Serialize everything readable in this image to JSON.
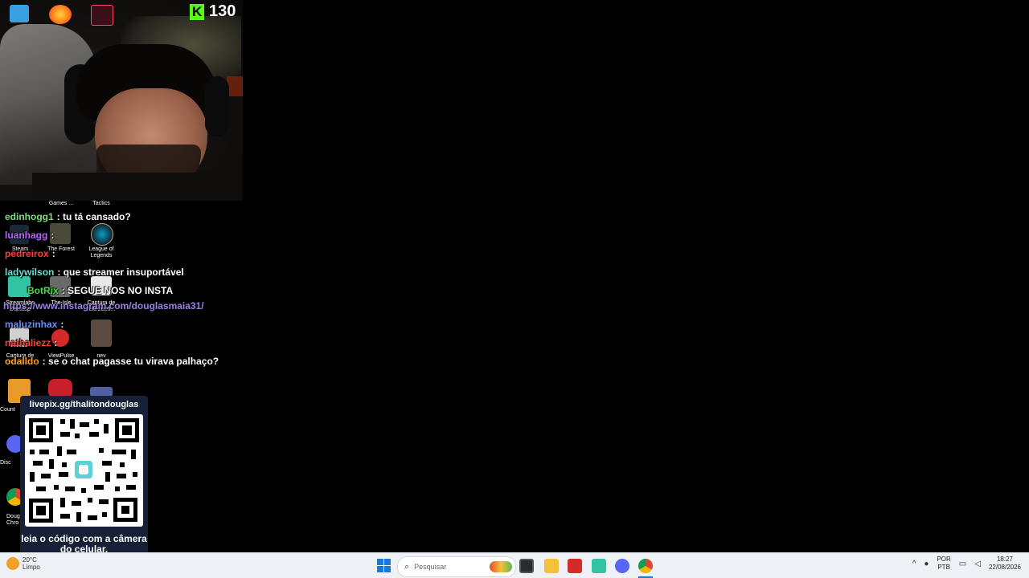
{
  "counter": {
    "value": "130"
  },
  "desktop_labels": {
    "games": "Games ...",
    "tactics": "Tactics",
    "steam": "Steam",
    "the_forest": "The Forest",
    "league": "League of Legends",
    "streamlabs": "Streamlabs Desktop",
    "the_isle": "The Isle",
    "captura1": "Captura de tela 2026...",
    "captura2": "Captura de tela 2026...",
    "viewpulse": "ViewPulse",
    "nev": "nev",
    "counter_strike": "Count",
    "discord": "Disc",
    "chrome": "Doug Chro"
  },
  "chat": {
    "m1": {
      "user": "edinhogg1",
      "sep": ":",
      "text": "tu tá cansado?"
    },
    "m2": {
      "user": "luanhagg",
      "sep": ":",
      "text": ""
    },
    "m3": {
      "user": "pedreirox",
      "sep": ":",
      "text": ""
    },
    "m4": {
      "user": "ladywilson",
      "sep": ":",
      "text": "que streamer insuportável"
    },
    "m5": {
      "user": "BotRix",
      "sep": ":",
      "text": "SEGUE NOS NO INSTA"
    },
    "link": "https://www.instagram.com/douglasmaia31/",
    "m6": {
      "user": "maluzinhax",
      "sep": ":",
      "text": ""
    },
    "m7": {
      "user": "nathaliezz",
      "sep": ":",
      "text": ""
    },
    "m8": {
      "user": "odalldo",
      "sep": ":",
      "text": "se o chat pagasse tu virava palhaço?"
    }
  },
  "colors": {
    "edinhogg1": "#7be07b",
    "luanhagg": "#b266ff",
    "pedreirox": "#ff3b3b",
    "ladywilson": "#5fe0d0",
    "BotRix": "#49d84b",
    "maluzinhax": "#6b8cff",
    "nathaliezz": "#ff3b3b",
    "odalldo": "#ff9f1a"
  },
  "qr": {
    "url": "livepix.gg/thalitondouglas",
    "caption": "leia o código com a câmera do celular."
  },
  "taskbar": {
    "weather_temp": "20°C",
    "weather_desc": "Limpo",
    "search_placeholder": "Pesquisar",
    "lang_1": "POR",
    "lang_2": "PTB",
    "time": "18:27",
    "date": "22/08/2026"
  }
}
